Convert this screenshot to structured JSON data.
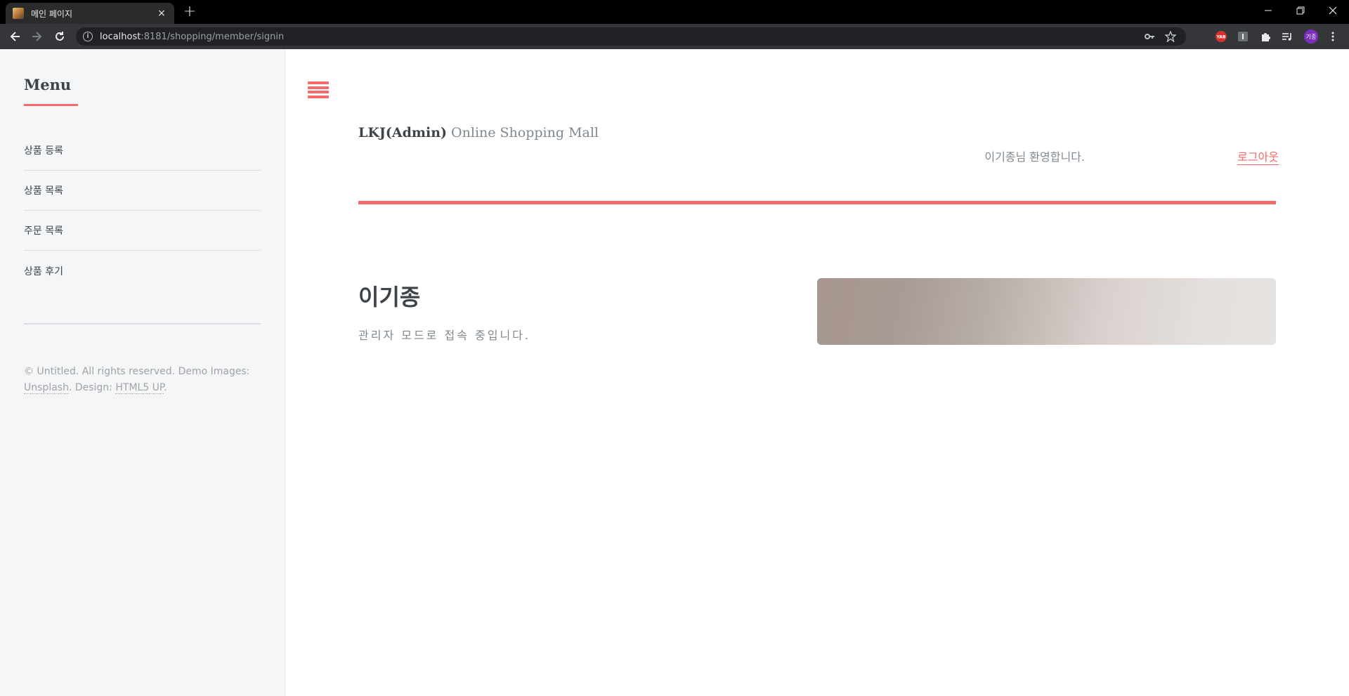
{
  "browser": {
    "tab_title": "메인 페이지",
    "tab_close": "×",
    "new_tab": "+",
    "url_host": "localhost",
    "url_rest": ":8181/shopping/member/signin",
    "window_controls": {
      "minimize": "—",
      "restore": "❐",
      "close": "✕"
    },
    "profile_initials": "기종",
    "extensions": [
      "yab-extension-icon",
      "i-extension-icon",
      "puzzle-icon",
      "reading-list-icon"
    ]
  },
  "sidebar": {
    "heading": "Menu",
    "items": [
      {
        "label": "상품 등록"
      },
      {
        "label": "상품 목록"
      },
      {
        "label": "주문 목록"
      },
      {
        "label": "상품 후기"
      }
    ],
    "footer": {
      "prefix": "© Untitled. All rights reserved. Demo Images:",
      "unsplash": "Unsplash",
      "design_label": ". Design:",
      "html5up": "HTML5 UP",
      "suffix": "."
    }
  },
  "header": {
    "brand_bold": "LKJ(Admin)",
    "brand_rest": " Online Shopping Mall",
    "welcome_text": "이기종님 환영합니다.",
    "logout_label": "로그아웃"
  },
  "banner": {
    "title": "이기종",
    "subtitle": "관리자 모드로 접속 중입니다."
  },
  "colors": {
    "accent": "#f56a6a",
    "heading": "#3d4449",
    "muted": "#7f888f",
    "sidebar_bg": "#f5f6f7"
  }
}
